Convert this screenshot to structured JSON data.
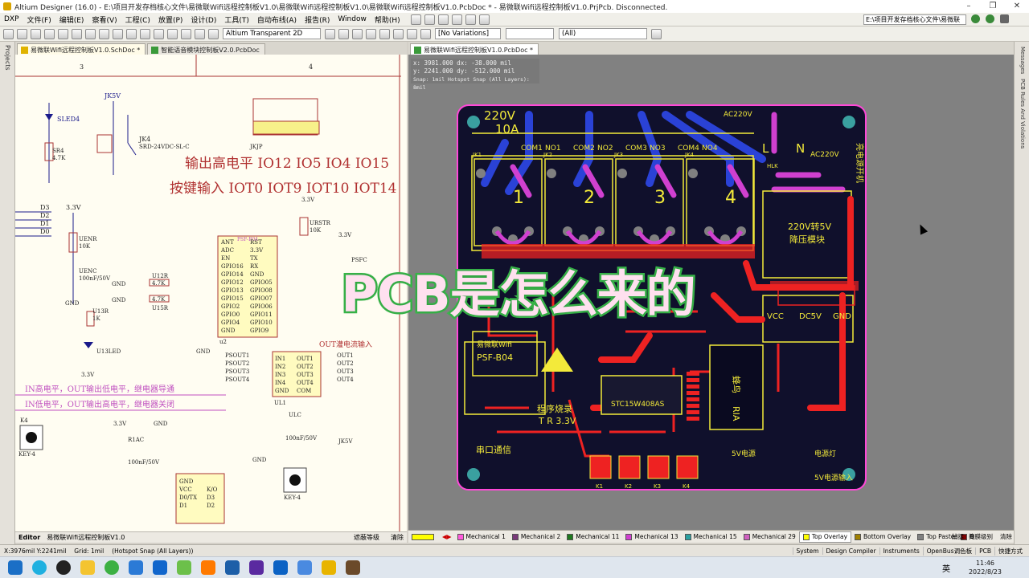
{
  "window": {
    "title": "Altium Designer (16.0) - E:\\项目开发存档核心文件\\易微联Wifi远程控制板V1.0\\易微联Wifi远程控制板V1.0\\易微联Wifi远程控制板V1.0.PcbDoc * - 易微联Wifi远程控制板V1.0.PrjPcb. Disconnected.",
    "path_right": "E:\\项目开发存档核心文件\\易微联"
  },
  "menu": [
    "DXP",
    "文件(F)",
    "编辑(E)",
    "察看(V)",
    "工程(C)",
    "放置(P)",
    "设计(D)",
    "工具(T)",
    "自动布线(A)",
    "报告(R)",
    "Window",
    "帮助(H)"
  ],
  "toolbar": {
    "view_config": "Altium Transparent 2D",
    "variations": "[No Variations]",
    "filter": "(All)"
  },
  "left_panel_label": "Projects",
  "right_panel_labels": [
    "Messages",
    "PCB Rules And Violations"
  ],
  "sch_tabs": [
    "易微联Wifi远程控制板V1.0.SchDoc *",
    "智能语音模块控制板V2.0.PcbDoc"
  ],
  "pcb_tab": "易微联Wifi远程控制板V1.0.PcbDoc *",
  "sch": {
    "col3": "3",
    "col4": "4",
    "line1": "输出高电平 IO12  IO5  IO4  IO15",
    "line2": "按键输入 IOT0  IOT9  IOT10  IOT14",
    "note1": "IN高电平，OUT输出低电平，继电器导通",
    "note2": "IN低电平，OUT输出高电平，继电器关闭",
    "out_label": "OUT灌电流输入",
    "relay": "JK4",
    "relay_model": "SRD-24VDC-SL-C",
    "jk5v": "JK5V",
    "jkjp": "JKJP",
    "led4": "SLED4",
    "sr4": "SR4",
    "sr4v": "4.7K",
    "uenr": "UENR",
    "uenrv": "10K",
    "uenc": "UENC",
    "uencv": "100nF/50V",
    "u12r": "U12R",
    "u15r": "U15R",
    "r47": "4.7K",
    "u13r": "U13R",
    "u13rv": "1K",
    "u13led": "U13LED",
    "urstr": "URSTR",
    "urstrv": "10K",
    "module": "PSF-B04",
    "u2": "u2",
    "v33": "3.3V",
    "gnd": "GND",
    "ul1": "UL1",
    "ulc": "ULC",
    "ulcv": "100nF/50V",
    "k4": "K4",
    "key4": "KEY-4",
    "r1ac": "R1AC",
    "r1acv": "100nF/50V",
    "jk5v2": "JK5V",
    "r1a": "R1A",
    "d_pins": [
      "D3",
      "D2",
      "D1",
      "D0"
    ],
    "mod_left": [
      "ANT",
      "ADC",
      "EN",
      "GPIO16",
      "GPIO14",
      "GPIO12",
      "GPIO13",
      "GPIO15",
      "GPIO2",
      "GPIO0",
      "GPIO4",
      "GND"
    ],
    "mod_right": [
      "RST",
      "3.3V",
      "TX",
      "RX",
      "GND",
      "GPIO05",
      "GPIO08",
      "GPIO07",
      "GPIO06",
      "GPIO11",
      "GPIO10",
      "GPIO9"
    ],
    "ul1_in": [
      "IN1",
      "IN2",
      "IN3",
      "IN4",
      "GND"
    ],
    "ul1_out": [
      "OUT1",
      "OUT2",
      "OUT3",
      "OUT4",
      "COM"
    ],
    "psout": [
      "PSOUT1",
      "PSOUT2",
      "PSOUT3",
      "PSOUT4"
    ],
    "out_nets": [
      "OUT1",
      "OUT2",
      "OUT3",
      "OUT4"
    ],
    "r1a_pins": [
      "GND",
      "VCC",
      "D0/TX",
      "D1",
      "K/O",
      "D3",
      "D2"
    ]
  },
  "sch_bottom": {
    "editor": "Editor",
    "doc": "易微联Wifi远程控制板V1.0",
    "btn1": "遮蔽等级",
    "btn2": "清除"
  },
  "pcb": {
    "coord_x": "x: 3981.000   dx: -38.000  mil",
    "coord_y": "y: 2241.000   dy: -512.000 mil",
    "coord_snap": "Snap: 1mil Hotspot Snap (All Layers): 8mil",
    "rating1": "220V",
    "rating2": "10A",
    "ac": "AC220V",
    "ac2": "AC220V",
    "relay_nums": [
      "1",
      "2",
      "3",
      "4"
    ],
    "com_labels": [
      "COM1",
      "NO1",
      "COM2",
      "NO2",
      "COM3",
      "NO3",
      "COM4",
      "NO4"
    ],
    "jk": [
      "JK1",
      "JK2",
      "JK3",
      "JK4"
    ],
    "psu1": "220V转5V",
    "psu2": "降压模块",
    "vcc": "VCC",
    "dc5v": "DC5V",
    "gnd": "GND",
    "wifi1": "易微联Wifi",
    "wifi2": "PSF-B04",
    "mcu": "STC15W408AS",
    "prog": "程序烧录",
    "txr": "T R 3.3V",
    "uart": "串口通信",
    "r1a_lbl1": "蜂鸟",
    "r1a_lbl2": "RIA",
    "v5": "5V电源",
    "power_lamp": "电源灯",
    "v5in": "5V电源输入",
    "key_lbls": [
      "K1",
      "K2",
      "K3",
      "K4"
    ],
    "side_text": "亮电源开机",
    "ln_l": "L",
    "ln_n": "N",
    "hlk": "HLK"
  },
  "overlay_text": "PCB是怎么来的",
  "layers": [
    {
      "name": "Mechanical 1",
      "color": "#ff5bdc"
    },
    {
      "name": "Mechanical 2",
      "color": "#7a3a7a"
    },
    {
      "name": "Mechanical 11",
      "color": "#1f7a1f"
    },
    {
      "name": "Mechanical 13",
      "color": "#d040d0"
    },
    {
      "name": "Mechanical 15",
      "color": "#2aa0a0"
    },
    {
      "name": "Mechanical 29",
      "color": "#d060c0"
    },
    {
      "name": "Top Overlay",
      "color": "#ffff00"
    },
    {
      "name": "Bottom Overlay",
      "color": "#a08000"
    },
    {
      "name": "Top Paste",
      "color": "#808080"
    },
    {
      "name": "B",
      "color": "#800000"
    }
  ],
  "layer_right": {
    "snap": "捕捉",
    "mask": "掩膜级别",
    "clear": "清除"
  },
  "status": {
    "coords": "X:3976mil Y:2241mil",
    "grid": "Grid: 1mil",
    "snap": "(Hotspot Snap (All Layers))",
    "right": [
      "System",
      "Design Compiler",
      "Instruments",
      "OpenBus调色板",
      "PCB",
      "快捷方式"
    ]
  },
  "clock": {
    "time": "11:46",
    "date": "2022/8/23",
    "lang": "英"
  },
  "colors": {
    "board": "#0f0f2e",
    "top_copper": "#ee2222",
    "bottom_copper": "#2a42d6",
    "silk": "#f3ea3a",
    "keepout": "#ff48d8",
    "sch_bg": "#fffdf2"
  }
}
